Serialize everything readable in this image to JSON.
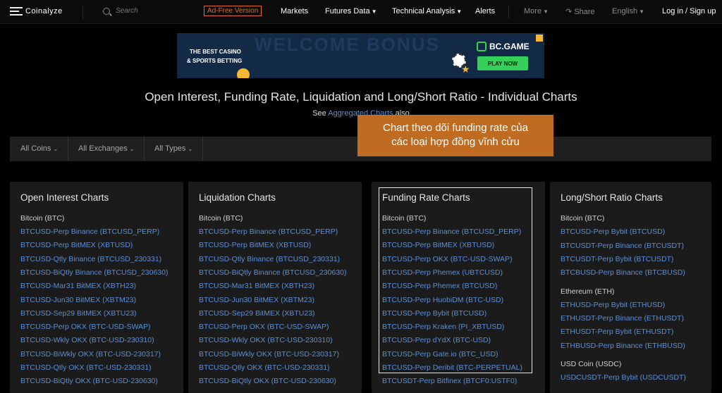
{
  "nav": {
    "brand": "Coinalyze",
    "search_placeholder": "Search",
    "adfree": "Ad-Free Version",
    "markets": "Markets",
    "futures": "Futures Data",
    "technical": "Technical Analysis",
    "alerts": "Alerts",
    "more": "More",
    "share": "Share",
    "language": "English",
    "login": "Log in / Sign up"
  },
  "banner": {
    "line1": "THE BEST CASINO",
    "line2": "& SPORTS BETTING",
    "bg_text": "WELCOME BONUS",
    "brand": "BC.GAME",
    "cta": "PLAY NOW"
  },
  "page": {
    "title": "Open Interest, Funding Rate, Liquidation and Long/Short Ratio - Individual Charts",
    "see_prefix": "See",
    "see_link": "Aggregated Charts",
    "see_suffix": "also"
  },
  "filters": {
    "coins": "All Coins",
    "exchanges": "All Exchanges",
    "types": "All Types"
  },
  "overlay": {
    "line1": "Chart theo dõi funding rate của",
    "line2": "các loại hợp đồng vĩnh cửu"
  },
  "cards": [
    {
      "title": "Open Interest Charts",
      "group": "Bitcoin (BTC)",
      "links": [
        "BTCUSD-Perp Binance (BTCUSD_PERP)",
        "BTCUSD-Perp BitMEX (XBTUSD)",
        "BTCUSD-Qtly Binance (BTCUSD_230331)",
        "BTCUSD-BiQtly Binance (BTCUSD_230630)",
        "BTCUSD-Mar31 BitMEX (XBTH23)",
        "BTCUSD-Jun30 BitMEX (XBTM23)",
        "BTCUSD-Sep29 BitMEX (XBTU23)",
        "BTCUSD-Perp OKX (BTC-USD-SWAP)",
        "BTCUSD-Wkly OKX (BTC-USD-230310)",
        "BTCUSD-BiWkly OKX (BTC-USD-230317)",
        "BTCUSD-Qtly OKX (BTC-USD-230331)",
        "BTCUSD-BiQtly OKX (BTC-USD-230630)"
      ]
    },
    {
      "title": "Liquidation Charts",
      "group": "Bitcoin (BTC)",
      "links": [
        "BTCUSD-Perp Binance (BTCUSD_PERP)",
        "BTCUSD-Perp BitMEX (XBTUSD)",
        "BTCUSD-Qtly Binance (BTCUSD_230331)",
        "BTCUSD-BiQtly Binance (BTCUSD_230630)",
        "BTCUSD-Mar31 BitMEX (XBTH23)",
        "BTCUSD-Jun30 BitMEX (XBTM23)",
        "BTCUSD-Sep29 BitMEX (XBTU23)",
        "BTCUSD-Perp OKX (BTC-USD-SWAP)",
        "BTCUSD-Wkly OKX (BTC-USD-230310)",
        "BTCUSD-BiWkly OKX (BTC-USD-230317)",
        "BTCUSD-Qtly OKX (BTC-USD-230331)",
        "BTCUSD-BiQtly OKX (BTC-USD-230630)"
      ]
    },
    {
      "title": "Funding Rate Charts",
      "group": "Bitcoin (BTC)",
      "links": [
        "BTCUSD-Perp Binance (BTCUSD_PERP)",
        "BTCUSD-Perp BitMEX (XBTUSD)",
        "BTCUSD-Perp OKX (BTC-USD-SWAP)",
        "BTCUSD-Perp Phemex (UBTCUSD)",
        "BTCUSD-Perp Phemex (BTCUSD)",
        "BTCUSD-Perp HuobiDM (BTC-USD)",
        "BTCUSD-Perp Bybit (BTCUSD)",
        "BTCUSD-Perp Kraken (PI_XBTUSD)",
        "BTCUSD-Perp dYdX (BTC-USD)",
        "BTCUSD-Perp Gate.io (BTC_USD)",
        "BTCUSD-Perp Deribit (BTC-PERPETUAL)",
        "BTCUSDT-Perp Bitfinex (BTCF0:USTF0)"
      ]
    },
    {
      "title": "Long/Short Ratio Charts",
      "groups": [
        {
          "name": "Bitcoin (BTC)",
          "links": [
            "BTCUSD-Perp Bybit (BTCUSD)",
            "BTCUSDT-Perp Binance (BTCUSDT)",
            "BTCUSDT-Perp Bybit (BTCUSDT)",
            "BTCBUSD-Perp Binance (BTCBUSD)"
          ]
        },
        {
          "name": "Ethereum (ETH)",
          "links": [
            "ETHUSD-Perp Bybit (ETHUSD)",
            "ETHUSDT-Perp Binance (ETHUSDT)",
            "ETHUSDT-Perp Bybit (ETHUSDT)",
            "ETHBUSD-Perp Binance (ETHBUSD)"
          ]
        },
        {
          "name": "USD Coin (USDC)",
          "links": [
            "USDCUSDT-Perp Bybit (USDCUSDT)"
          ]
        }
      ]
    }
  ]
}
